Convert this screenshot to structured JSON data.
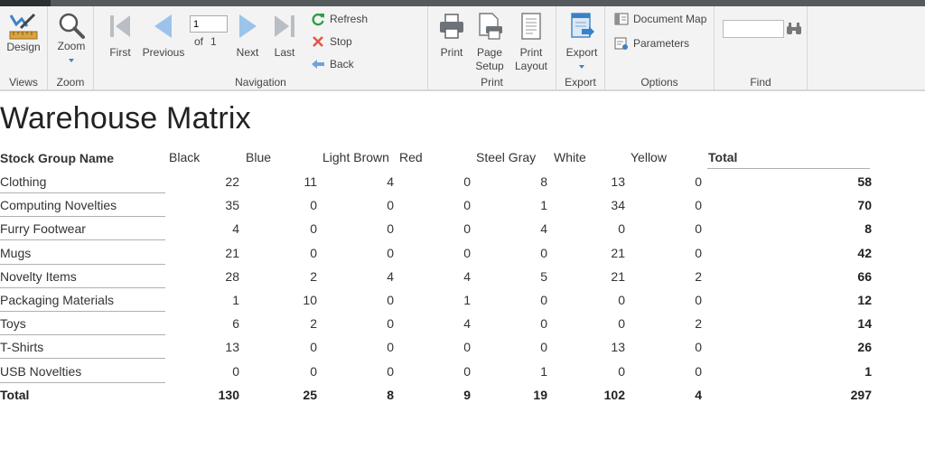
{
  "toolbar": {
    "views": {
      "group_label": "Views",
      "design_label": "Design"
    },
    "zoom": {
      "group_label": "Zoom",
      "zoom_label": "Zoom"
    },
    "navigation": {
      "group_label": "Navigation",
      "first_label": "First",
      "previous_label": "Previous",
      "page_value": "1",
      "of_label": "of",
      "total_pages": "1",
      "next_label": "Next",
      "last_label": "Last",
      "refresh_label": "Refresh",
      "stop_label": "Stop",
      "back_label": "Back"
    },
    "print": {
      "group_label": "Print",
      "print_label": "Print",
      "page_setup_label_1": "Page",
      "page_setup_label_2": "Setup",
      "print_layout_label_1": "Print",
      "print_layout_label_2": "Layout"
    },
    "export": {
      "group_label": "Export",
      "export_label": "Export"
    },
    "options": {
      "group_label": "Options",
      "document_map_label": "Document Map",
      "parameters_label": "Parameters"
    },
    "find": {
      "group_label": "Find",
      "value": ""
    }
  },
  "report": {
    "title": "Warehouse Matrix",
    "row_header": "Stock Group Name",
    "columns": [
      "Black",
      "Blue",
      "Light Brown",
      "Red",
      "Steel Gray",
      "White",
      "Yellow"
    ],
    "total_header": "Total",
    "rows": [
      {
        "name": "Clothing",
        "values": [
          "22",
          "11",
          "4",
          "0",
          "8",
          "13",
          "0"
        ],
        "total": "58"
      },
      {
        "name": "Computing Novelties",
        "values": [
          "35",
          "0",
          "0",
          "0",
          "1",
          "34",
          "0"
        ],
        "total": "70"
      },
      {
        "name": "Furry Footwear",
        "values": [
          "4",
          "0",
          "0",
          "0",
          "4",
          "0",
          "0"
        ],
        "total": "8"
      },
      {
        "name": "Mugs",
        "values": [
          "21",
          "0",
          "0",
          "0",
          "0",
          "21",
          "0"
        ],
        "total": "42"
      },
      {
        "name": "Novelty Items",
        "values": [
          "28",
          "2",
          "4",
          "4",
          "5",
          "21",
          "2"
        ],
        "total": "66"
      },
      {
        "name": "Packaging Materials",
        "values": [
          "1",
          "10",
          "0",
          "1",
          "0",
          "0",
          "0"
        ],
        "total": "12"
      },
      {
        "name": "Toys",
        "values": [
          "6",
          "2",
          "0",
          "4",
          "0",
          "0",
          "2"
        ],
        "total": "14"
      },
      {
        "name": "T-Shirts",
        "values": [
          "13",
          "0",
          "0",
          "0",
          "0",
          "13",
          "0"
        ],
        "total": "26"
      },
      {
        "name": "USB Novelties",
        "values": [
          "0",
          "0",
          "0",
          "0",
          "1",
          "0",
          "0"
        ],
        "total": "1"
      }
    ],
    "total_row": {
      "name": "Total",
      "values": [
        "130",
        "25",
        "8",
        "9",
        "19",
        "102",
        "4"
      ],
      "total": "297"
    }
  },
  "colors": {
    "accent": "#3b82c4",
    "ribbon_bg": "#f3f3f3"
  }
}
